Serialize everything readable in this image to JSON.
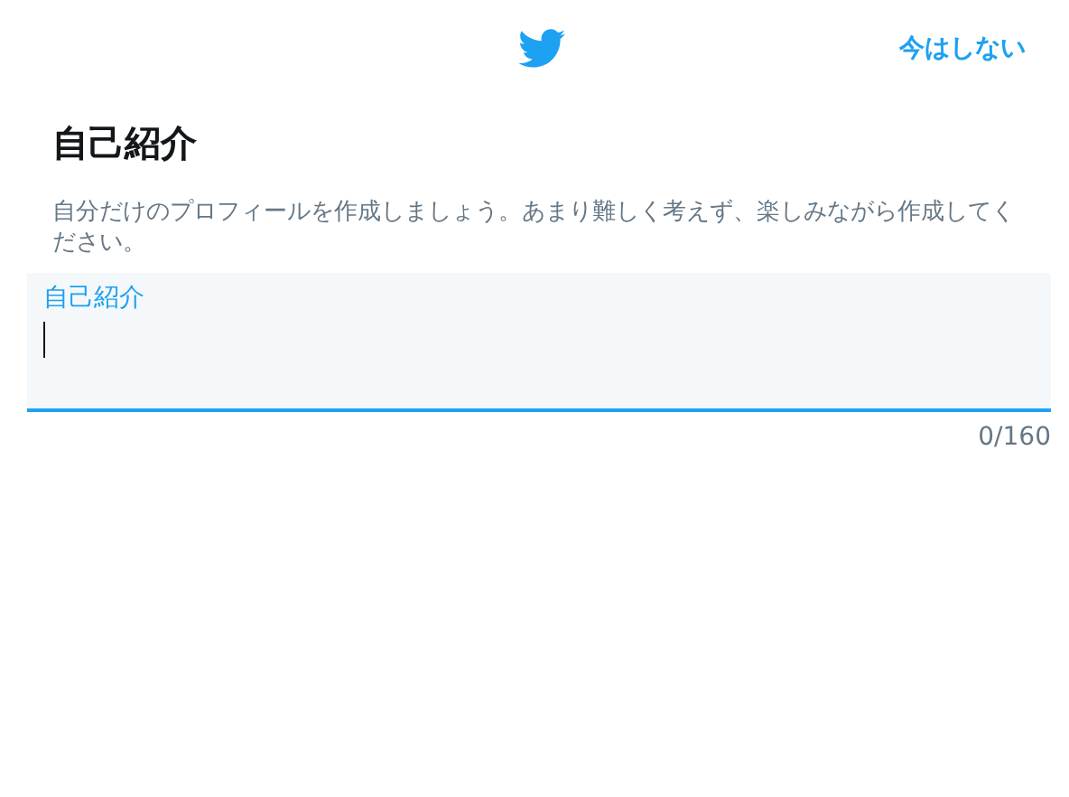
{
  "header": {
    "skip_button": "今はしない"
  },
  "title": "自己紹介",
  "description": "自分だけのプロフィールを作成しましょう。あまり難しく考えず、楽しみながら作成してください。",
  "bio_field": {
    "label": "自己紹介",
    "focused": true
  },
  "counter": "0/160"
}
